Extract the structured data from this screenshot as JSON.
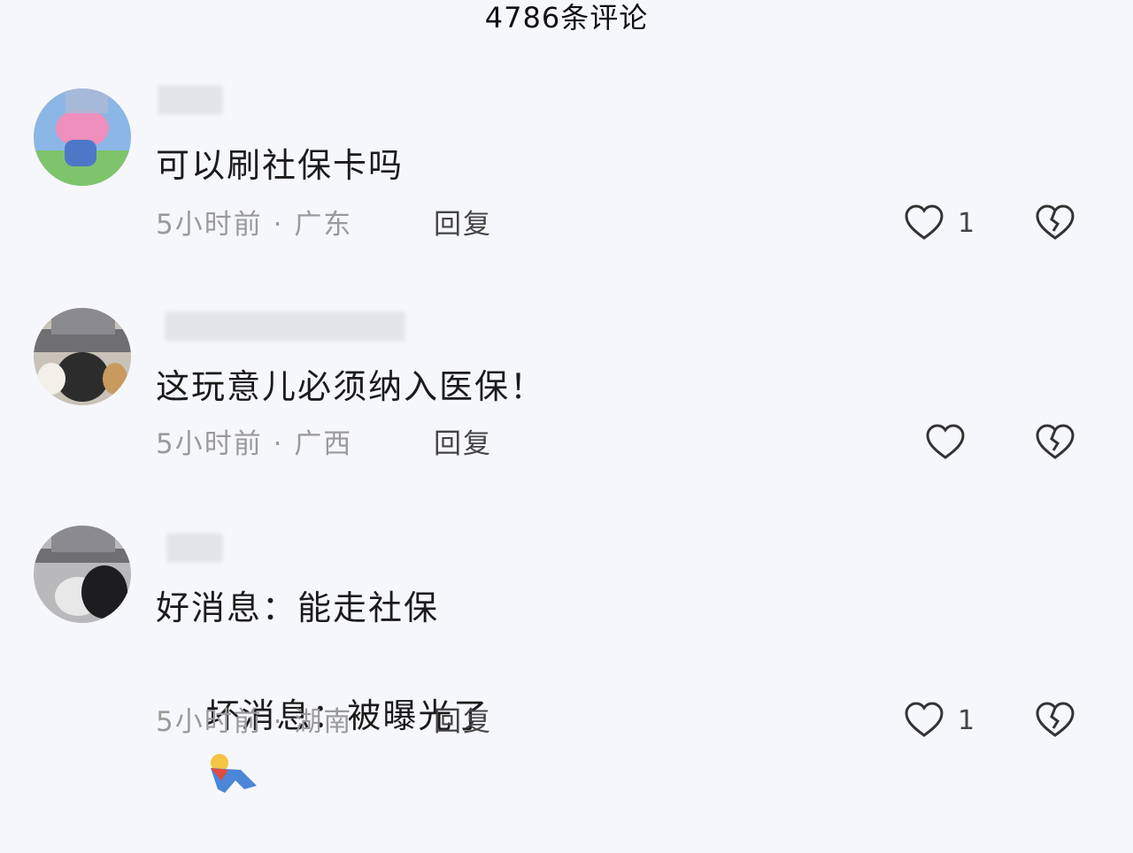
{
  "header": {
    "title": "4786条评论"
  },
  "comments": [
    {
      "text": "可以刷社保卡吗",
      "time": "5小时前",
      "separator": "·",
      "location": "广东",
      "reply_label": "回复",
      "likes": "1"
    },
    {
      "text": "这玩意儿必须纳入医保！",
      "time": "5小时前",
      "separator": "·",
      "location": "广西",
      "reply_label": "回复",
      "likes": ""
    },
    {
      "text_line1": "好消息：能走社保",
      "text_line2": "坏消息：被曝光了",
      "time": "5小时前",
      "separator": "·",
      "location": "湖南",
      "reply_label": "回复",
      "likes": "1"
    }
  ],
  "icons": {
    "like": "heart-outline-icon",
    "dislike": "broken-heart-icon",
    "emoji": "sticker-emoji-icon"
  },
  "colors": {
    "background": "#f6f7fb",
    "meta_text": "#9a9a9a",
    "main_text": "#1b1b1b"
  }
}
